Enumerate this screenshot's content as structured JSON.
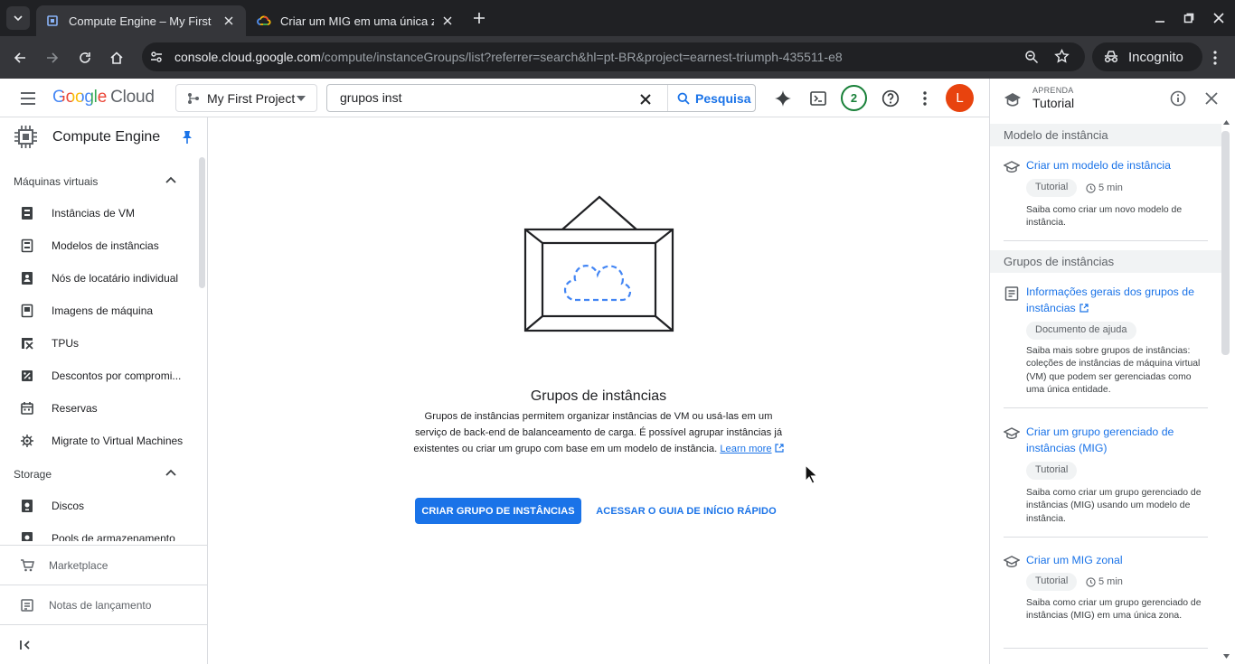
{
  "browser": {
    "tabs": [
      {
        "title": "Compute Engine – My First P",
        "active": true
      },
      {
        "title": "Criar um MIG em uma única z",
        "active": false
      }
    ],
    "url_host": "console.cloud.google.com",
    "url_path": "/compute/instanceGroups/list?referrer=search&hl=pt-BR&project=earnest-triumph-435511-e8",
    "incognito_label": "Incognito"
  },
  "header": {
    "logo_google": "Google",
    "logo_cloud": "Cloud",
    "project": "My First Project",
    "search_value": "grupos inst",
    "search_button": "Pesquisa",
    "notifications_count": "2",
    "avatar_letter": "L"
  },
  "sidebar": {
    "product": "Compute Engine",
    "sections": [
      {
        "title": "Máquinas virtuais",
        "items": [
          {
            "label": "Instâncias de VM",
            "icon": "vm-icon"
          },
          {
            "label": "Modelos de instâncias",
            "icon": "template-icon"
          },
          {
            "label": "Nós de locatário individual",
            "icon": "tenant-icon"
          },
          {
            "label": "Imagens de máquina",
            "icon": "image-icon"
          },
          {
            "label": "TPUs",
            "icon": "tpu-icon"
          },
          {
            "label": "Descontos por compromi...",
            "icon": "discount-icon"
          },
          {
            "label": "Reservas",
            "icon": "calendar-icon"
          },
          {
            "label": "Migrate to Virtual Machines",
            "icon": "migrate-icon"
          }
        ]
      },
      {
        "title": "Storage",
        "items": [
          {
            "label": "Discos",
            "icon": "disk-icon"
          },
          {
            "label": "Pools de armazenamento",
            "icon": "pool-icon"
          }
        ]
      }
    ],
    "footer": {
      "marketplace": "Marketplace",
      "release_notes": "Notas de lançamento"
    }
  },
  "main": {
    "title": "Grupos de instâncias",
    "description": "Grupos de instâncias permitem organizar instâncias de VM ou usá-las em um serviço de back-end de balanceamento de carga. É possível agrupar instâncias já existentes ou criar um grupo com base em um modelo de instância.",
    "learn_more_1": "Learn",
    "learn_more_2": "more",
    "primary_button": "CRIAR GRUPO DE INSTÂNCIAS",
    "secondary_button": "ACESSAR O GUIA DE INÍCIO RÁPIDO"
  },
  "panel": {
    "kicker": "APRENDA",
    "title": "Tutorial",
    "sections": [
      {
        "title": "Modelo de instância"
      },
      {
        "title": "Grupos de instâncias"
      }
    ],
    "cards": [
      {
        "title": "Criar um modelo de instância",
        "tag": "Tutorial",
        "duration": "5 min",
        "desc": "Saiba como criar um novo modelo de instância."
      },
      {
        "title": "Informações gerais dos grupos de instâncias",
        "tag": "Documento de ajuda",
        "duration": "",
        "desc": "Saiba mais sobre grupos de instâncias: coleções de instâncias de máquina virtual (VM) que podem ser gerenciadas como uma única entidade."
      },
      {
        "title": "Criar um grupo gerenciado de instâncias (MIG)",
        "tag": "Tutorial",
        "duration": "",
        "desc": "Saiba como criar um grupo gerenciado de instâncias (MIG) usando um modelo de instância."
      },
      {
        "title": "Criar um MIG zonal",
        "tag": "Tutorial",
        "duration": "5 min",
        "desc": "Saiba como criar um grupo gerenciado de instâncias (MIG) em uma única zona."
      }
    ]
  },
  "colors": {
    "accent": "#1a73e8",
    "chrome_dark": "#202124",
    "chrome_tab": "#35363a",
    "avatar": "#e8430e",
    "notif": "#188038"
  }
}
